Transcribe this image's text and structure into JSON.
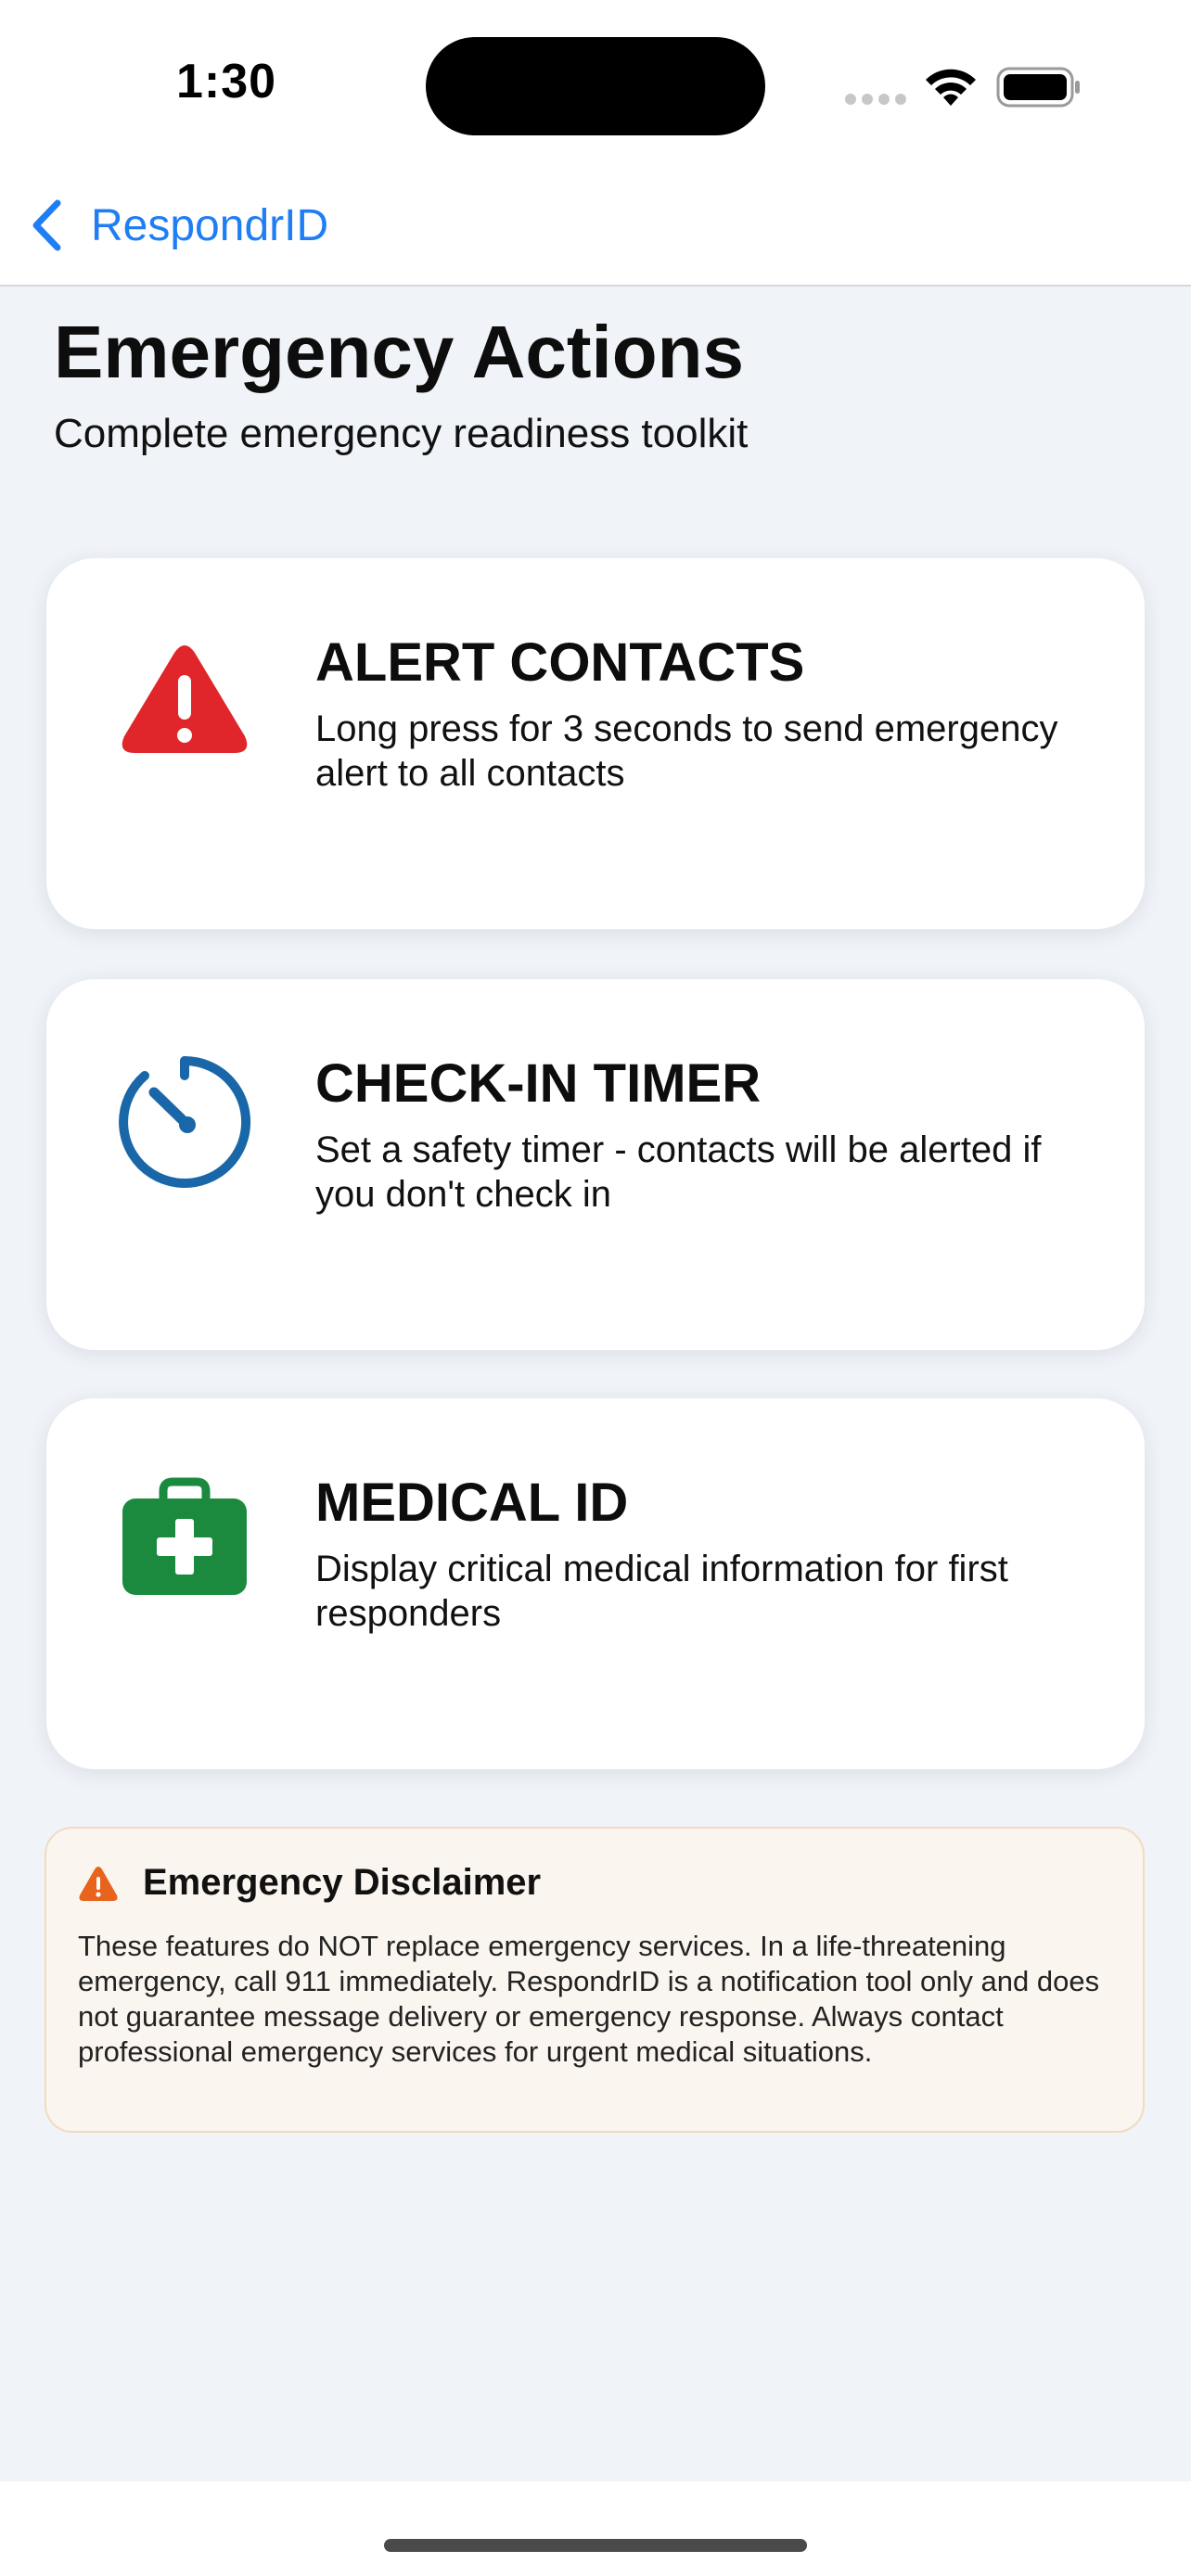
{
  "status_bar": {
    "time": "1:30"
  },
  "nav": {
    "back_label": "RespondrID"
  },
  "header": {
    "title": "Emergency Actions",
    "subtitle": "Complete emergency readiness toolkit"
  },
  "cards": [
    {
      "title": "ALERT CONTACTS",
      "description": "Long press for 3 seconds to send emergency alert to all contacts",
      "icon": "warning-triangle-icon",
      "color": "#e0262b"
    },
    {
      "title": "CHECK-IN TIMER",
      "description": "Set a safety timer - contacts will be alerted if you don't check in",
      "icon": "timer-icon",
      "color": "#1967a8"
    },
    {
      "title": "MEDICAL ID",
      "description": "Display critical medical information for first responders",
      "icon": "medical-kit-icon",
      "color": "#1b8a3e"
    }
  ],
  "disclaimer": {
    "title": "Emergency Disclaimer",
    "text": "These features do NOT replace emergency services. In a life-threatening emergency, call 911 immediately. RespondrID is a notification tool only and does not guarantee message delivery or emergency response. Always contact professional emergency services for urgent medical situations.",
    "icon": "warning-icon",
    "color": "#e8631c"
  },
  "colors": {
    "accent": "#1f7ef4",
    "background": "#f0f3f8"
  }
}
